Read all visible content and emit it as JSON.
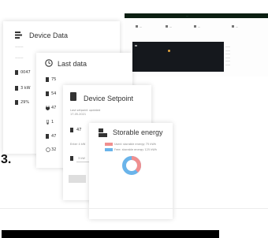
{
  "dashboard": {
    "header_title": "···",
    "tabs": [
      "—",
      "—",
      "—",
      "—"
    ],
    "side_list": [
      "——",
      "——",
      "——",
      "——",
      "——",
      "——"
    ]
  },
  "device_data": {
    "title": "Device Data",
    "subtitle": "———",
    "label": "———",
    "rows": [
      "0047",
      "3 kW",
      "29%"
    ]
  },
  "last_data": {
    "title": "Last data",
    "rows": [
      "75",
      "54",
      "47",
      "1",
      "47",
      "32"
    ]
  },
  "device_setpoint": {
    "title": "Device Setpoint",
    "updated": "Last setpoint updated 17.05.2021",
    "rows": [
      "47",
      "Enter 4 kW",
      "3 kW"
    ]
  },
  "storable_energy": {
    "title": "Storable energy",
    "legend": [
      {
        "label": "Used: storable energy 75 kWh",
        "color": "#f08f8f"
      },
      {
        "label": "Free: storable energy 125 kWh",
        "color": "#6ab4ea"
      }
    ],
    "donut": {
      "used_fraction": 0.38
    }
  },
  "section_label": "3."
}
